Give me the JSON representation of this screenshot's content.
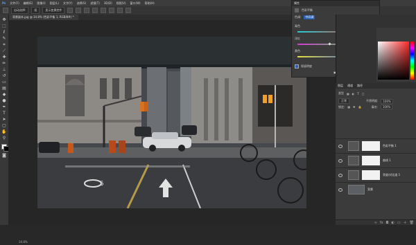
{
  "menubar": {
    "items": [
      "文件(F)",
      "编辑(E)",
      "图像(I)",
      "图层(L)",
      "文字(Y)",
      "选择(S)",
      "滤镜(T)",
      "3D(D)",
      "视图(V)",
      "窗口(W)",
      "帮助(H)"
    ]
  },
  "optbar": {
    "auto_select_label": "自动选择:",
    "group_label": "组",
    "transform_label": "显示变换控件"
  },
  "document": {
    "tab_label": "背景副本.jpg @ 34.8% (色彩平衡 1, RGB/8#) *"
  },
  "status": {
    "zoom": "34.8%"
  },
  "properties_panel": {
    "header": "属性",
    "adjustment_name": "色彩平衡",
    "tone_label": "色调:",
    "tone_value": "中间调",
    "slider_rows": [
      {
        "left": "青色",
        "right": "红色",
        "value": "+20",
        "fraction": 0.7
      },
      {
        "left": "洋红",
        "right": "绿色",
        "value": "0",
        "fraction": 0.5
      },
      {
        "left": "黄色",
        "right": "蓝色",
        "value": "+12",
        "fraction": 0.62
      }
    ],
    "preserve_label": "保留明度"
  },
  "layers_panel": {
    "tabs": [
      "图层",
      "通道",
      "路径"
    ],
    "kind_label": "类型",
    "blend_mode": "正常",
    "opacity_label": "不透明度:",
    "opacity_value": "100%",
    "lock_label": "锁定:",
    "fill_label": "填充:",
    "fill_value": "100%",
    "layers": [
      {
        "name": "色彩平衡 1",
        "type": "adjustment",
        "thumb_icon": "balance-icon"
      },
      {
        "name": "曲线 1",
        "type": "adjustment",
        "thumb_icon": "curves-icon"
      },
      {
        "name": "亮度/对比度 1",
        "type": "adjustment",
        "thumb_icon": "sun-icon"
      },
      {
        "name": "背景",
        "type": "image",
        "thumb_icon": "photo-thumb"
      }
    ]
  },
  "colors": {
    "ui_bg": "#282828",
    "panel_bg": "#3b3b3b",
    "accent": "#2b5fae"
  }
}
